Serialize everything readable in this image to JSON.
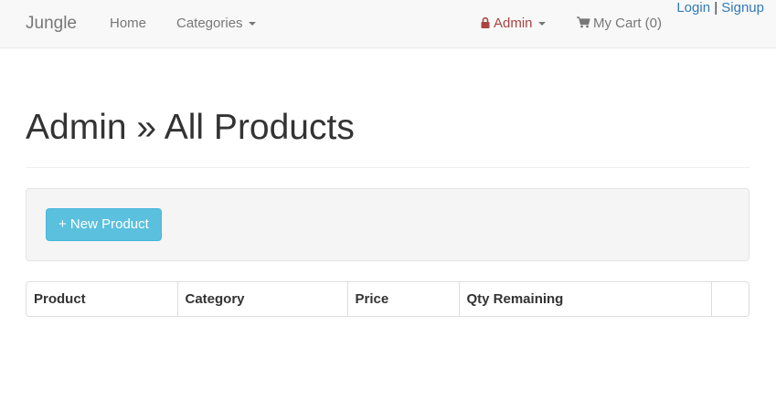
{
  "navbar": {
    "brand": "Jungle",
    "home": "Home",
    "categories": "Categories",
    "admin": "Admin",
    "cart": "My Cart (0)",
    "login": "Login",
    "separator": "|",
    "signup": "Signup"
  },
  "page": {
    "title": "Admin » All Products"
  },
  "actions": {
    "new_product": "+ New Product"
  },
  "table": {
    "headers": [
      "Product",
      "Category",
      "Price",
      "Qty Remaining",
      ""
    ]
  },
  "colors": {
    "admin": "#a94442",
    "link": "#337ab7",
    "button": "#5bc0de"
  },
  "icons": {
    "admin": "lock-icon",
    "cart": "shopping-cart-icon",
    "dropdown": "caret-down-icon"
  }
}
